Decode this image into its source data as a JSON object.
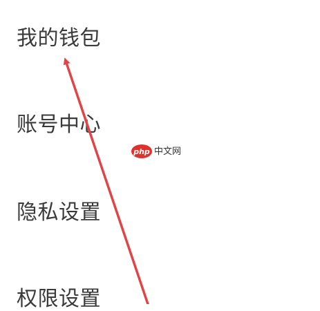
{
  "menu": {
    "items": [
      {
        "label": "我的钱包"
      },
      {
        "label": "账号中心"
      },
      {
        "label": "隐私设置"
      },
      {
        "label": "权限设置"
      }
    ]
  },
  "watermark": {
    "logo_text": "php",
    "site_text": "中文网"
  },
  "annotation": {
    "arrow_color": "#e04444",
    "points_to": "我的钱包"
  }
}
